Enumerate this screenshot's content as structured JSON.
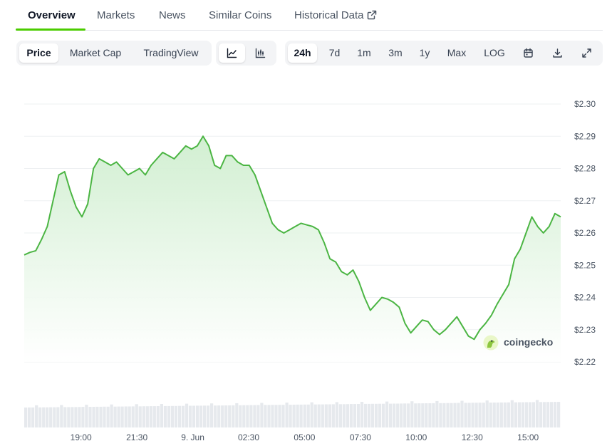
{
  "tabs": {
    "overview": "Overview",
    "markets": "Markets",
    "news": "News",
    "similar": "Similar Coins",
    "historical": "Historical Data"
  },
  "chart_type_options": {
    "price": "Price",
    "market_cap": "Market Cap",
    "tradingview": "TradingView"
  },
  "ranges": {
    "r24h": "24h",
    "r7d": "7d",
    "r1m": "1m",
    "r3m": "3m",
    "r1y": "1y",
    "max": "Max",
    "log": "LOG"
  },
  "watermark": "coingecko",
  "colors": {
    "line": "#4bb543",
    "fill_top": "#cfeecf",
    "grid": "#eef0f2",
    "volume": "#e6e9ed",
    "accent": "#4bcc00"
  },
  "chart_data": {
    "type": "area",
    "ylim": [
      2.22,
      2.3
    ],
    "yticks": [
      "$2.30",
      "$2.29",
      "$2.28",
      "$2.27",
      "$2.26",
      "$2.25",
      "$2.24",
      "$2.23",
      "$2.22"
    ],
    "xticks": [
      {
        "label": "19:00",
        "t": 2.54
      },
      {
        "label": "21:30",
        "t": 5.04
      },
      {
        "label": "9. Jun",
        "t": 7.54
      },
      {
        "label": "02:30",
        "t": 10.04
      },
      {
        "label": "05:00",
        "t": 12.54
      },
      {
        "label": "07:30",
        "t": 15.04
      },
      {
        "label": "10:00",
        "t": 17.54
      },
      {
        "label": "12:30",
        "t": 20.04
      },
      {
        "label": "15:00",
        "t": 22.54
      }
    ],
    "t_range": [
      0,
      24
    ],
    "series": [
      {
        "values": [
          2.2532,
          2.254,
          2.2545,
          2.258,
          2.262,
          2.27,
          2.278,
          2.279,
          2.273,
          2.268,
          2.265,
          2.269,
          2.28,
          2.283,
          2.282,
          2.281,
          2.282,
          2.28,
          2.278,
          2.279,
          2.28,
          2.278,
          2.281,
          2.283,
          2.285,
          2.284,
          2.283,
          2.285,
          2.287,
          2.286,
          2.287,
          2.29,
          2.287,
          2.281,
          2.28,
          2.284,
          2.284,
          2.282,
          2.281,
          2.281,
          2.278,
          2.273,
          2.268,
          2.263,
          2.261,
          2.26,
          2.261,
          2.262,
          2.263,
          2.2625,
          2.262,
          2.261,
          2.257,
          2.252,
          2.251,
          2.248,
          2.247,
          2.2485,
          2.245,
          2.24,
          2.236,
          2.238,
          2.24,
          2.2395,
          2.2385,
          2.237,
          2.232,
          2.229,
          2.231,
          2.233,
          2.2325,
          2.23,
          2.2285,
          2.23,
          2.232,
          2.234,
          2.231,
          2.228,
          2.227,
          2.23,
          2.232,
          2.2345,
          2.238,
          2.241,
          2.244,
          2.252,
          2.255,
          2.26,
          2.265,
          2.262,
          2.26,
          2.262,
          2.266,
          2.265
        ]
      }
    ]
  }
}
